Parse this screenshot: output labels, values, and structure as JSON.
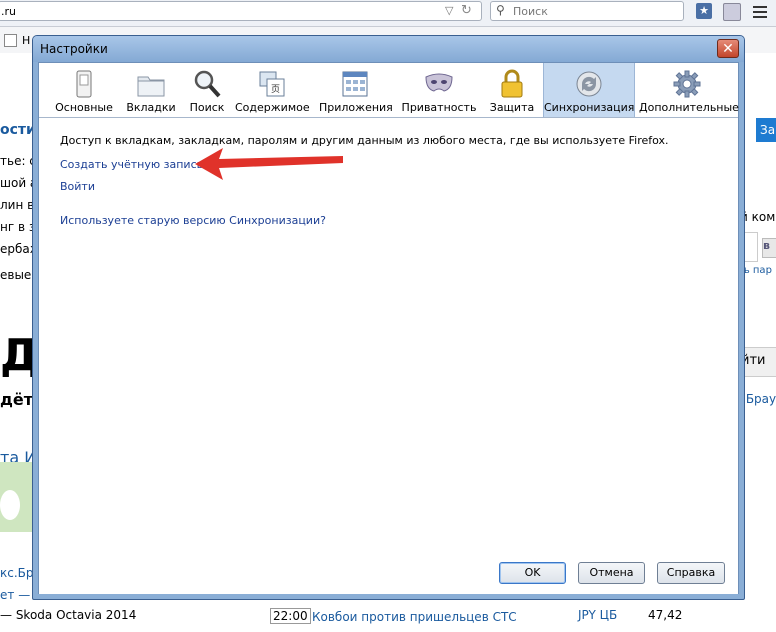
{
  "browser": {
    "url_fragment": ".ru",
    "search_placeholder": "Поиск",
    "bookmark_letter": "Н"
  },
  "background_page": {
    "texts": [
      "ости",
      "тье: с",
      "шой а",
      "лин в",
      "нг в з",
      "ербаж",
      "евые",
      "Д",
      "дёт",
      "та И",
      "кс.Бр",
      "ет —",
      "— Skoda Octavia 2014",
      "22:00",
      "Ковбои против пришельцев СТС",
      "JPY ЦБ",
      "47,42",
      "За",
      "й ком",
      "ть пар",
      "йти",
      ".Брау",
      "в"
    ]
  },
  "dialog": {
    "title": "Настройки",
    "tabs": [
      {
        "label": "Основные",
        "icon": "switch-icon"
      },
      {
        "label": "Вкладки",
        "icon": "folder-tabs-icon"
      },
      {
        "label": "Поиск",
        "icon": "magnifier-icon"
      },
      {
        "label": "Содержимое",
        "icon": "content-icon"
      },
      {
        "label": "Приложения",
        "icon": "applications-icon"
      },
      {
        "label": "Приватность",
        "icon": "mask-icon"
      },
      {
        "label": "Защита",
        "icon": "padlock-icon"
      },
      {
        "label": "Синхронизация",
        "icon": "sync-icon",
        "selected": true
      },
      {
        "label": "Дополнительные",
        "icon": "gear-icon"
      }
    ],
    "sync": {
      "intro": "Доступ к вкладкам, закладкам, паролям и другим данным из любого места, где вы используете Firefox.",
      "create_account": "Создать учётную запись",
      "sign_in": "Войти",
      "old_version": "Используете старую версию Синхронизации?"
    },
    "buttons": {
      "ok": "OK",
      "cancel": "Отмена",
      "help": "Справка"
    }
  },
  "colors": {
    "link": "#1c3f94",
    "annotation_arrow": "#e0322a",
    "selected_tab": "#c5d9f0",
    "dialog_frame": "#8aaed6"
  }
}
